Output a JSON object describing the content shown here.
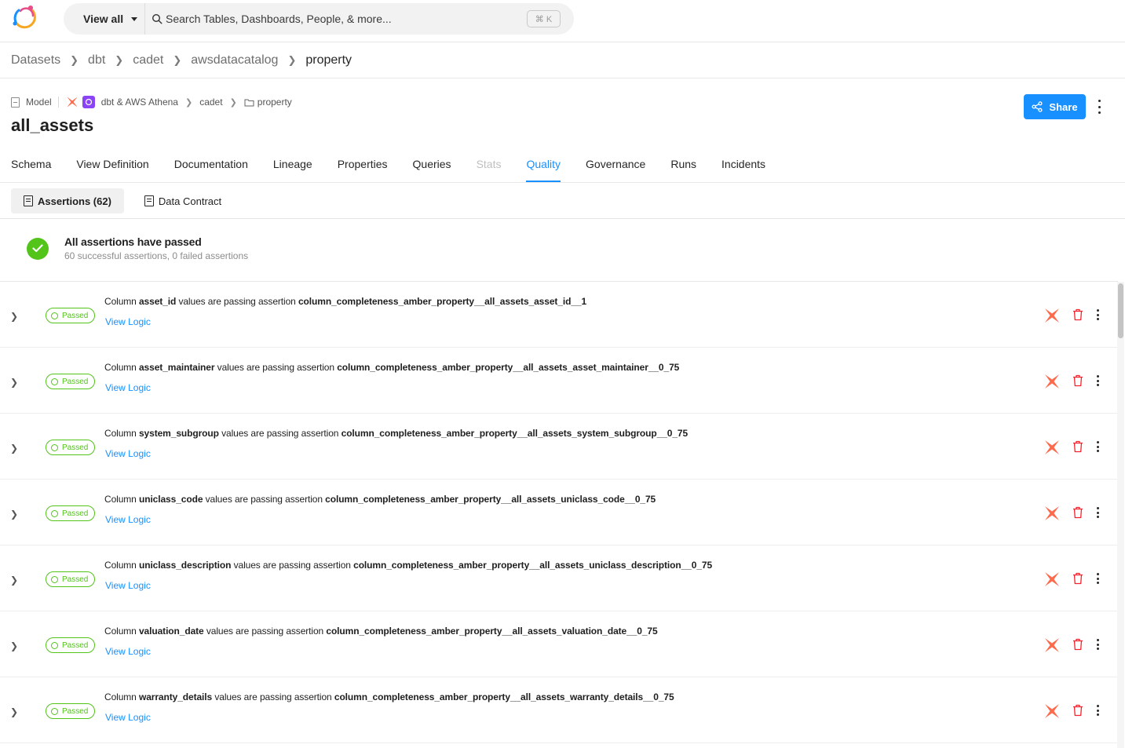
{
  "search": {
    "scope_label": "View all",
    "placeholder": "Search Tables, Dashboards, People, & more...",
    "shortcut": "⌘ K"
  },
  "breadcrumb": [
    "Datasets",
    "dbt",
    "cadet",
    "awsdatacatalog",
    "property"
  ],
  "entity": {
    "type_label": "Model",
    "platform_label": "dbt & AWS Athena",
    "container": "cadet",
    "folder": "property",
    "name": "all_assets",
    "share_label": "Share"
  },
  "tabs": [
    {
      "label": "Schema",
      "state": "normal"
    },
    {
      "label": "View Definition",
      "state": "normal"
    },
    {
      "label": "Documentation",
      "state": "normal"
    },
    {
      "label": "Lineage",
      "state": "normal"
    },
    {
      "label": "Properties",
      "state": "normal"
    },
    {
      "label": "Queries",
      "state": "normal"
    },
    {
      "label": "Stats",
      "state": "disabled"
    },
    {
      "label": "Quality",
      "state": "active"
    },
    {
      "label": "Governance",
      "state": "normal"
    },
    {
      "label": "Runs",
      "state": "normal"
    },
    {
      "label": "Incidents",
      "state": "normal"
    }
  ],
  "subtabs": {
    "assertions_label": "Assertions (62)",
    "contract_label": "Data Contract"
  },
  "summary": {
    "title": "All assertions have passed",
    "subtitle": "60 successful assertions, 0 failed assertions"
  },
  "assertion_text": {
    "prefix": "Column",
    "middle": "values are passing assertion",
    "status": "Passed",
    "view_logic": "View Logic"
  },
  "assertions": [
    {
      "column": "asset_id",
      "assertion": "column_completeness_amber_property__all_assets_asset_id__1"
    },
    {
      "column": "asset_maintainer",
      "assertion": "column_completeness_amber_property__all_assets_asset_maintainer__0_75"
    },
    {
      "column": "system_subgroup",
      "assertion": "column_completeness_amber_property__all_assets_system_subgroup__0_75"
    },
    {
      "column": "uniclass_code",
      "assertion": "column_completeness_amber_property__all_assets_uniclass_code__0_75"
    },
    {
      "column": "uniclass_description",
      "assertion": "column_completeness_amber_property__all_assets_uniclass_description__0_75"
    },
    {
      "column": "valuation_date",
      "assertion": "column_completeness_amber_property__all_assets_valuation_date__0_75"
    },
    {
      "column": "warranty_details",
      "assertion": "column_completeness_amber_property__all_assets_warranty_details__0_75"
    }
  ],
  "colors": {
    "accent": "#1890ff",
    "success": "#52c41a",
    "dbt": "#ff694b",
    "delete": "#f5222d",
    "athena": "#8b43f6"
  }
}
